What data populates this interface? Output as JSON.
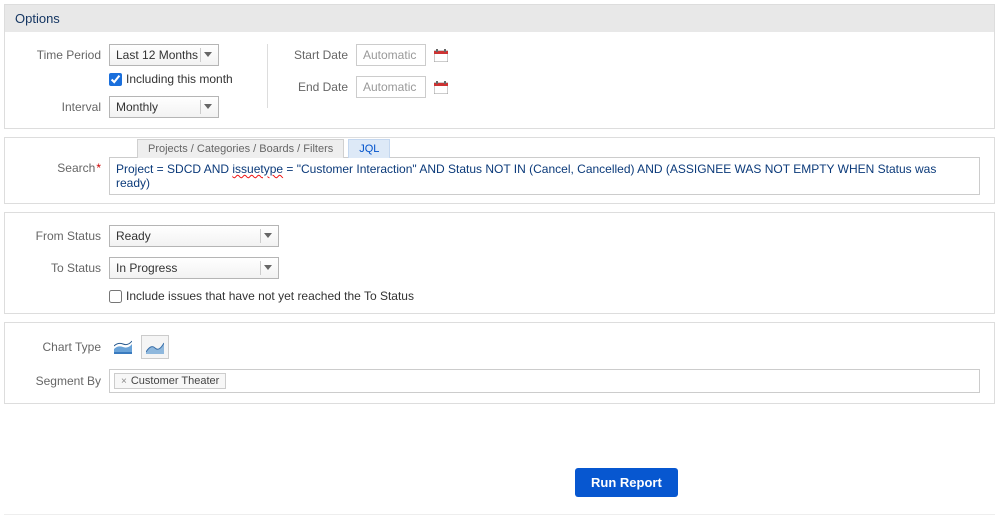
{
  "header": {
    "title": "Options"
  },
  "time": {
    "period_label": "Time Period",
    "period_value": "Last 12 Months",
    "include_label": "Including this month",
    "include_checked": true,
    "interval_label": "Interval",
    "interval_value": "Monthly"
  },
  "dates": {
    "start_label": "Start Date",
    "start_placeholder": "Automatic",
    "end_label": "End Date",
    "end_placeholder": "Automatic"
  },
  "search": {
    "label": "Search",
    "tab_projects": "Projects / Categories / Boards / Filters",
    "tab_jql": "JQL",
    "jql_prefix": "Project = SDCD AND ",
    "jql_issuetype_word": "issuetype",
    "jql_suffix": " = \"Customer Interaction\" AND Status NOT IN (Cancel, Cancelled) AND (ASSIGNEE WAS NOT EMPTY WHEN Status was ready)"
  },
  "status": {
    "from_label": "From Status",
    "from_value": "Ready",
    "to_label": "To Status",
    "to_value": "In Progress",
    "include_not_reached_label": "Include issues that have not yet reached the To Status",
    "include_not_reached_checked": false
  },
  "chart": {
    "type_label": "Chart Type",
    "segment_label": "Segment By",
    "segment_tag": "Customer Theater"
  },
  "actions": {
    "run_label": "Run Report"
  }
}
